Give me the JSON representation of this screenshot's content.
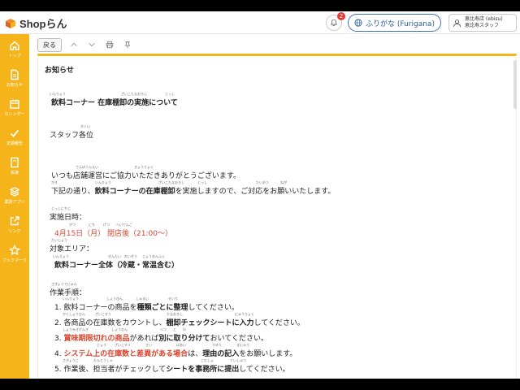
{
  "header": {
    "logo_text": "Shopらん",
    "bell_count": "2",
    "furigana_label": "ふりがな (Furigana)",
    "user_line1": "恵比寿店 (ebisu)",
    "user_line2": "恵比寿スタッフ"
  },
  "sidebar": {
    "items": [
      {
        "label": "トップ",
        "icon": "home-icon"
      },
      {
        "label": "お知らせ",
        "icon": "document-icon"
      },
      {
        "label": "カレンダー",
        "icon": "calendar-icon"
      },
      {
        "label": "定期報告",
        "icon": "check-icon"
      },
      {
        "label": "帳簿",
        "icon": "book-icon"
      },
      {
        "label": "業務アプリ",
        "icon": "layers-icon"
      },
      {
        "label": "リンク",
        "icon": "external-link-icon"
      },
      {
        "label": "ブックマーク",
        "icon": "star-icon"
      }
    ]
  },
  "toolbar": {
    "back_label": "戻る"
  },
  "notice": {
    "section_title": "お知らせ",
    "title": "飲料コーナー 在庫棚卸の実施について",
    "title_ruby_1": "いんりょう",
    "title_ruby_2": "ざいこたなおろし",
    "title_ruby_3": "じっし",
    "greeting": "スタッフ各位",
    "greeting_ruby": "かくい",
    "para1": "いつも店舗運営にご協力いただきありがとうございます。",
    "para1_ruby_1": "てんぽうんえい",
    "para1_ruby_2": "きょうりょく",
    "para2_a": "下記の通り、",
    "para2_b": "飲料コーナーの在庫棚卸",
    "para2_c": "を実施しますので、ご対応をお願いいたします。",
    "para2_ruby_1": "かき",
    "para2_ruby_2": "いんりょう",
    "para2_ruby_3": "ざいこたなおろし",
    "para2_ruby_4": "じっし",
    "para2_ruby_5": "たいおう",
    "para2_ruby_6": "ねが",
    "date_label": "実施日時：",
    "date_label_ruby": "じっしにちじ",
    "date_value": "4月15日（月） 閉店後（21:00〜）",
    "date_ruby_1": "がつ",
    "date_ruby_2": "にち",
    "date_ruby_3": "げつ",
    "date_ruby_4": "へいてんご",
    "area_label": "対象エリア：",
    "area_label_ruby": "たいしょう",
    "area_value": "飲料コーナー全体（冷蔵・常温含む）",
    "area_ruby_1": "いんりょう",
    "area_ruby_2": "ぜんたい",
    "area_ruby_3": "れいぞう",
    "area_ruby_4": "じょうおんふく",
    "steps_label": "作業手順：",
    "steps_label_ruby": "さぎょうてじゅん",
    "step1_a": "1. 飲料コーナーの商品を",
    "step1_b": "種類ごとに整理",
    "step1_c": "してください。",
    "step1_ruby_1": "いんりょう",
    "step1_ruby_2": "しょうひん",
    "step1_ruby_3": "しゅるい",
    "step1_ruby_4": "せいり",
    "step2_a": "2. 各商品の在庫数をカウントし、",
    "step2_b": "棚卸チェックシートに入力",
    "step2_c": "してください。",
    "step2_ruby_1": "かくしょうひん",
    "step2_ruby_2": "ざいこすう",
    "step2_ruby_3": "たなおろし",
    "step2_ruby_4": "にゅうりょく",
    "step3_a": "3. ",
    "step3_b": "賞味期限切れの商品",
    "step3_c": "があれば",
    "step3_d": "別に取り分けて",
    "step3_e": "おいてください。",
    "step3_ruby_1": "しょうみきげんぎ",
    "step3_ruby_2": "しょうひん",
    "step3_ruby_3": "べつ",
    "step3_ruby_4": "と",
    "step3_ruby_5": "わ",
    "step4_a": "4. ",
    "step4_b": "システム上の在庫数と差異がある場合",
    "step4_c": "は、",
    "step4_d": "理由の記入",
    "step4_e": "をお願いします。",
    "step4_ruby_1": "じょう",
    "step4_ruby_2": "ざいこすう",
    "step4_ruby_3": "さい",
    "step4_ruby_4": "ばあい",
    "step4_ruby_5": "りゆう",
    "step4_ruby_6": "きにゅう",
    "step5_a": "5. 作業後、担当者がチェックして",
    "step5_b": "シートを事務所に提出",
    "step5_c": "してください。",
    "step5_ruby_1": "さぎょうご",
    "step5_ruby_2": "たんとうしゃ",
    "step5_ruby_3": "じむしょ",
    "step5_ruby_4": "ていしゅつ"
  },
  "colors": {
    "accent": "#f4b41a",
    "highlight_red": "#d9452f",
    "link_blue": "#2a5d9a"
  }
}
